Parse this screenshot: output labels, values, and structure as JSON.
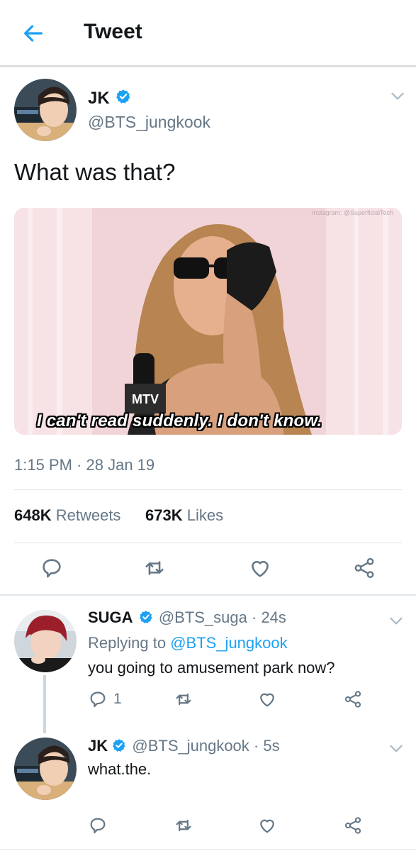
{
  "header": {
    "title": "Tweet"
  },
  "tweet": {
    "author_name": "JK",
    "author_handle": "@BTS_jungkook",
    "text": "What was that?",
    "media": {
      "caption": "I can't read suddenly. I don't know.",
      "watermark": "Instagram: @SuperficialTech"
    },
    "time": "1:15 PM",
    "date": "28 Jan 19",
    "date_separator": " · ",
    "retweets_count": "648K",
    "retweets_label": "Retweets",
    "likes_count": "673K",
    "likes_label": "Likes"
  },
  "replies": [
    {
      "author_name": "SUGA",
      "author_handle": "@BTS_suga",
      "age": "24s",
      "replying_to_prefix": "Replying to",
      "replying_to_handle": "@BTS_jungkook",
      "text": "you going to amusement park now?",
      "reply_count": "1"
    },
    {
      "author_name": "JK",
      "author_handle": "@BTS_jungkook",
      "age": "5s",
      "text": "what.the."
    }
  ],
  "icons": {
    "back": "arrow-left-icon",
    "verified": "verified-badge-icon",
    "reply": "reply-icon",
    "retweet": "retweet-icon",
    "like": "heart-icon",
    "share": "share-icon",
    "caret": "chevron-down-icon"
  },
  "colors": {
    "accent": "#1da1f2",
    "muted": "#657786",
    "text": "#14171a",
    "divider": "#e1e8ed"
  }
}
